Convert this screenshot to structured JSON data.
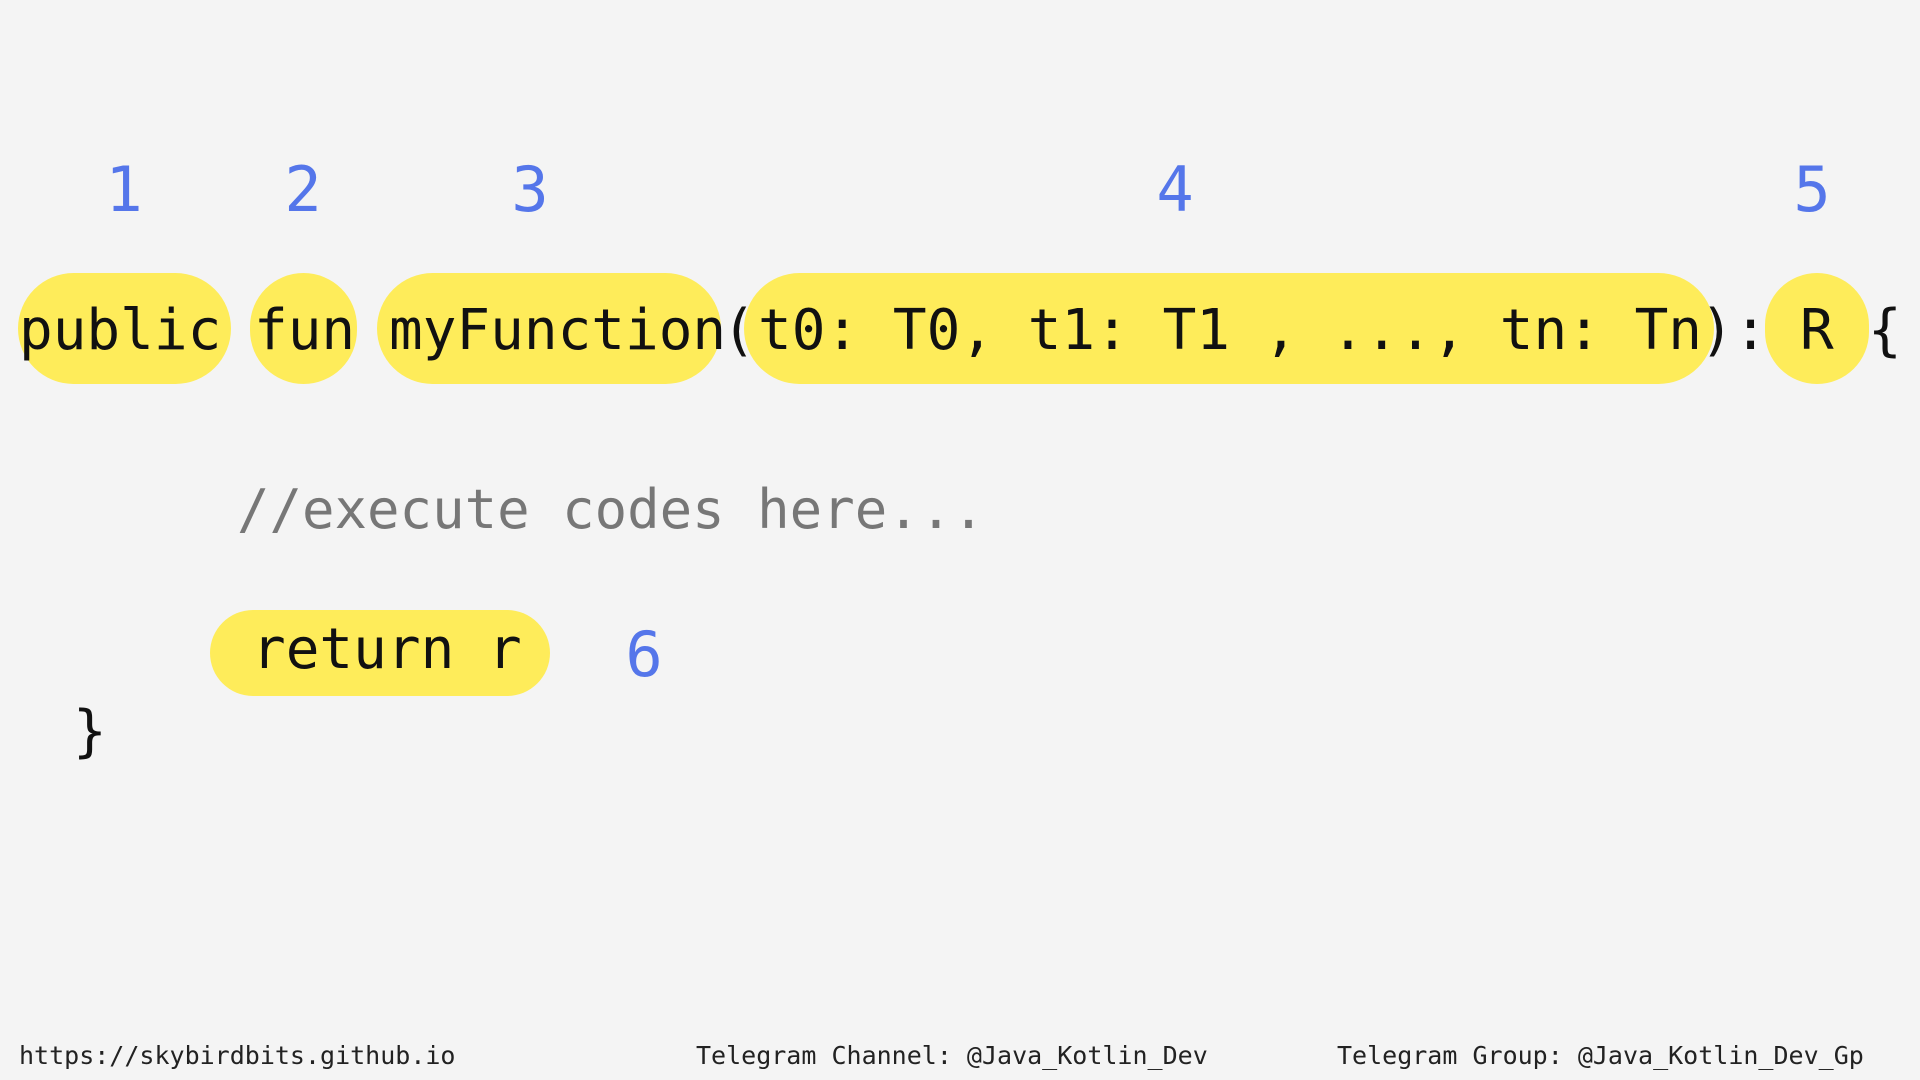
{
  "numbers": [
    "1",
    "2",
    "3",
    "4",
    "5",
    "6"
  ],
  "signature": {
    "modifier": "public",
    "keyword": "fun",
    "name": "myFunction",
    "open_paren": "(",
    "params": "t0: T0, t1: T1 , ..., tn: Tn",
    "close_colon": "):",
    "return_type": "R",
    "open_brace": "{"
  },
  "body": {
    "comment": "//execute codes here...",
    "return_stmt": "return r",
    "close_brace": "}"
  },
  "footer": {
    "website": "https://skybirdbits.github.io",
    "channel": "Telegram Channel: @Java_Kotlin_Dev",
    "group": "Telegram Group: @Java_Kotlin_Dev_Gp"
  },
  "colors": {
    "highlight": "#feec5a",
    "number": "#5576ea",
    "comment": "#777777",
    "background": "#f4f4f4"
  }
}
